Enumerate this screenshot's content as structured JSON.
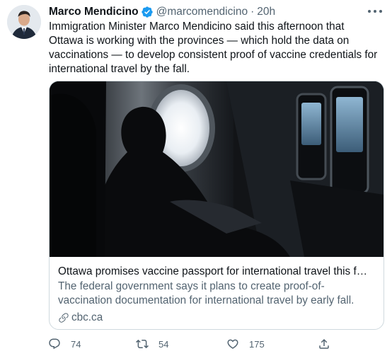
{
  "tweet": {
    "author_name": "Marco Mendicino",
    "handle": "@marcomendicino",
    "separator": "·",
    "time": "20h",
    "text": "Immigration Minister Marco Mendicino said this afternoon that Ottawa is working with the provinces — which hold the data on vaccinations — to develop consistent proof of vaccine credentials for international travel by the fall.",
    "verified": true
  },
  "card": {
    "title": "Ottawa promises vaccine passport for international travel this fall | CB...",
    "description": "The federal government says it plans to create proof-of-vaccination documentation for international travel by early fall.",
    "domain": "cbc.ca"
  },
  "actions": {
    "reply_count": "74",
    "retweet_count": "54",
    "like_count": "175"
  },
  "icons": {
    "verified": "verified-badge-icon",
    "more": "more-icon",
    "link": "link-icon",
    "reply": "reply-icon",
    "retweet": "retweet-icon",
    "like": "heart-icon",
    "share": "share-icon"
  },
  "colors": {
    "text_primary": "#0f1419",
    "text_secondary": "#536471",
    "verified_blue": "#1d9bf0",
    "card_border": "#cfd9de"
  }
}
